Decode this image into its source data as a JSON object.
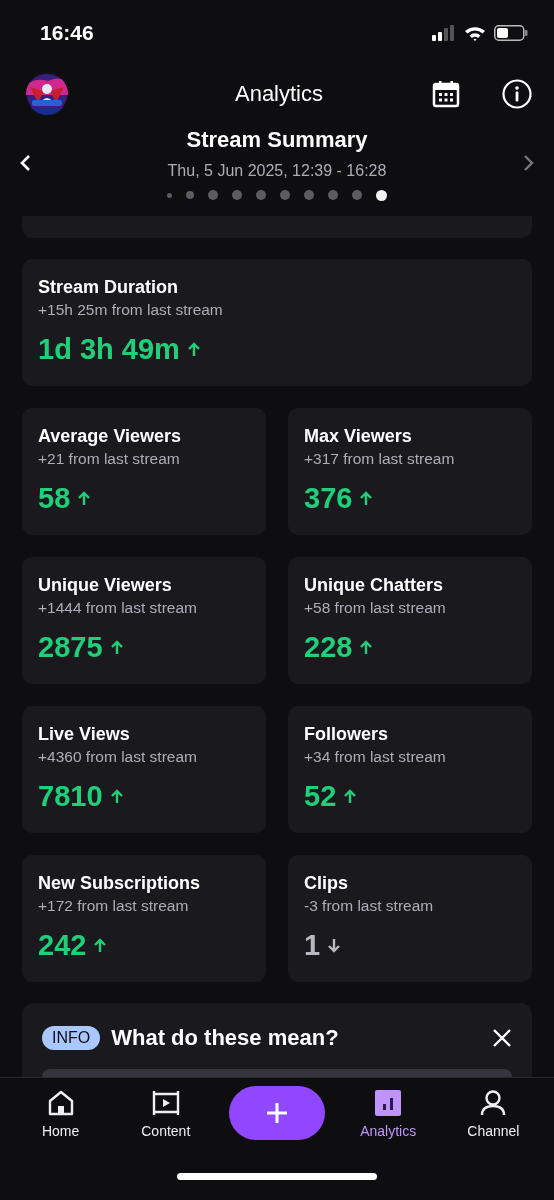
{
  "status_bar": {
    "time": "16:46"
  },
  "header": {
    "title": "Analytics"
  },
  "summary": {
    "title": "Stream Summary",
    "date": "Thu, 5 Jun 2025, 12:39 - 16:28",
    "pages": [
      {
        "selected": false
      },
      {
        "selected": false
      },
      {
        "selected": false
      },
      {
        "selected": false
      },
      {
        "selected": false
      },
      {
        "selected": false
      },
      {
        "selected": false
      },
      {
        "selected": false
      },
      {
        "selected": false
      },
      {
        "selected": true
      }
    ]
  },
  "metrics": [
    {
      "kind": "wide",
      "title": "Stream Duration",
      "delta": "+15h 25m from last stream",
      "value": "1d 3h 49m",
      "increased": true
    },
    {
      "kind": "half",
      "title": "Average Viewers",
      "delta": "+21 from last stream",
      "value": "58",
      "increased": true
    },
    {
      "kind": "half",
      "title": "Max Viewers",
      "delta": "+317 from last stream",
      "value": "376",
      "increased": true
    },
    {
      "kind": "half",
      "title": "Unique Viewers",
      "delta": "+1444 from last stream",
      "value": "2875",
      "increased": true
    },
    {
      "kind": "half",
      "title": "Unique Chatters",
      "delta": "+58 from last stream",
      "value": "228",
      "increased": true
    },
    {
      "kind": "half",
      "title": "Live Views",
      "delta": "+4360 from last stream",
      "value": "7810",
      "increased": true
    },
    {
      "kind": "half",
      "title": "Followers",
      "delta": "+34 from last stream",
      "value": "52",
      "increased": true
    },
    {
      "kind": "half",
      "title": "New Subscriptions",
      "delta": "+172 from last stream",
      "value": "242",
      "increased": true
    },
    {
      "kind": "half",
      "title": "Clips",
      "delta": "-3 from last stream",
      "value": "1",
      "increased": false
    }
  ],
  "info_card": {
    "badge": "INFO",
    "title": "What do these mean?"
  },
  "tab_bar": [
    {
      "kind": "home",
      "label": "Home",
      "selected": false
    },
    {
      "kind": "content",
      "label": "Content",
      "selected": false
    },
    {
      "kind": "create"
    },
    {
      "kind": "analytics",
      "label": "Analytics",
      "selected": true
    },
    {
      "kind": "channel",
      "label": "Channel",
      "selected": false
    }
  ]
}
